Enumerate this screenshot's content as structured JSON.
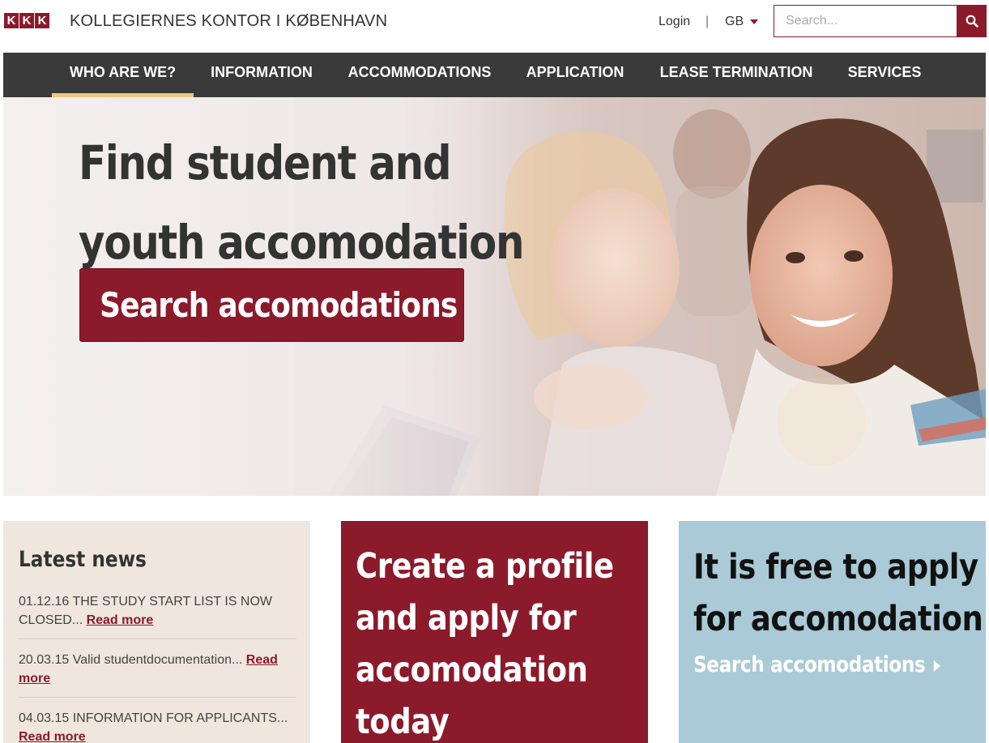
{
  "header": {
    "logo_letters": [
      "K",
      "K",
      "K"
    ],
    "site_name": "KOLLEGIERNES KONTOR I KØBENHAVN",
    "login_label": "Login",
    "separator": "|",
    "language": "GB",
    "search_placeholder": "Search...",
    "search_icon": "search-icon"
  },
  "nav": {
    "items": [
      {
        "label": "WHO ARE WE?",
        "active": true
      },
      {
        "label": "INFORMATION",
        "active": false
      },
      {
        "label": "ACCOMMODATIONS",
        "active": false
      },
      {
        "label": "APPLICATION",
        "active": false
      },
      {
        "label": "LEASE TERMINATION",
        "active": false
      },
      {
        "label": "SERVICES",
        "active": false
      }
    ]
  },
  "hero": {
    "title_line1": "Find student and",
    "title_line2": "youth accomodation",
    "button_label": "Search accomodations"
  },
  "news": {
    "heading": "Latest news",
    "items": [
      {
        "text": "01.12.16 THE STUDY START LIST IS NOW CLOSED... ",
        "link": "Read more"
      },
      {
        "text": "20.03.15 Valid studentdocumentation... ",
        "link": "Read more"
      },
      {
        "text": "04.03.15 INFORMATION FOR APPLICANTS... ",
        "link": "Read more"
      }
    ]
  },
  "profile_tile": {
    "text": "Create a profile and apply for accomodation today"
  },
  "free_tile": {
    "text": "It is free to apply for accomodation",
    "link": "Search accomodations"
  },
  "colors": {
    "brand_red": "#8b1a2b",
    "nav_bg": "#3a3a3a",
    "nav_active_underline": "#f1c97a",
    "news_bg": "#efe6dd",
    "free_bg": "#a9cad6"
  }
}
